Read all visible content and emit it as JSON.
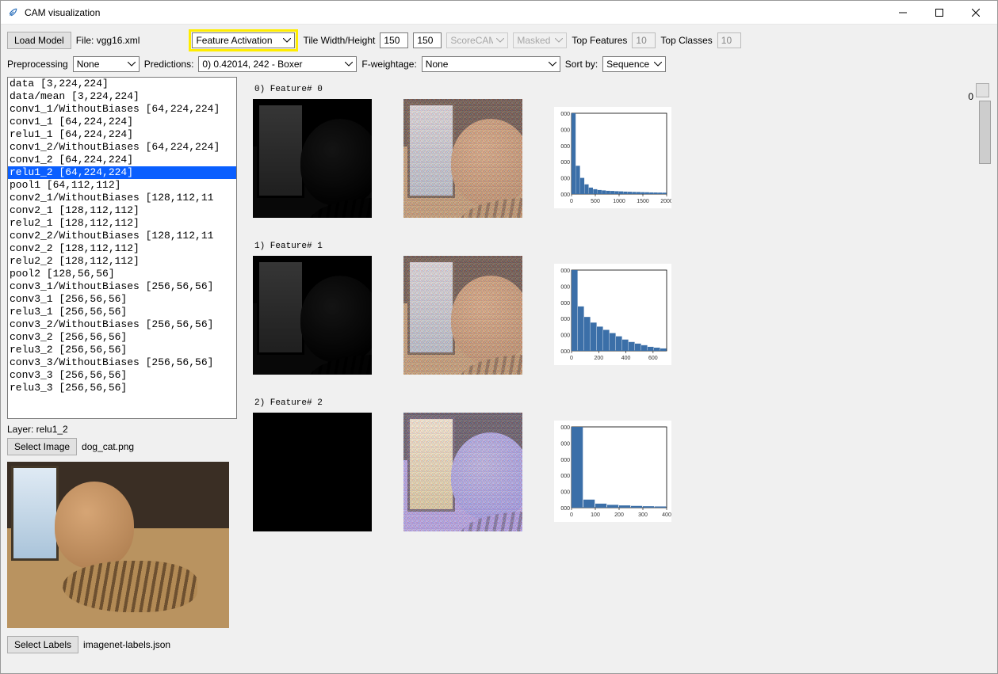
{
  "window": {
    "title": "CAM visualization"
  },
  "toolbar1": {
    "load_model": "Load Model",
    "file_label": "File:",
    "file_value": "vgg16.xml",
    "mode_select": "Feature Activation",
    "tile_label": "Tile Width/Height",
    "tile_w": "150",
    "tile_h": "150",
    "scorecam": "ScoreCAM",
    "masked": "Masked",
    "top_features_label": "Top Features",
    "top_features_value": "10",
    "top_classes_label": "Top Classes",
    "top_classes_value": "10"
  },
  "toolbar2": {
    "preproc_label": "Preprocessing",
    "preproc_value": "None",
    "pred_label": "Predictions:",
    "pred_value": "0) 0.42014,  242 - Boxer",
    "fweight_label": "F-weightage:",
    "fweight_value": "None",
    "sort_label": "Sort by:",
    "sort_value": "Sequence"
  },
  "layers": [
    {
      "name": "data",
      "shape": "[3,224,224]",
      "pad": 22
    },
    {
      "name": "data/mean",
      "shape": "[3,224,224]",
      "pad": 22
    },
    {
      "name": "conv1_1/WithoutBiases",
      "shape": "[64,224,224]",
      "pad": 2
    },
    {
      "name": "conv1_1",
      "shape": "[64,224,224]",
      "pad": 22
    },
    {
      "name": "relu1_1",
      "shape": "[64,224,224]",
      "pad": 22
    },
    {
      "name": "conv1_2/WithoutBiases",
      "shape": "[64,224,224]",
      "pad": 2
    },
    {
      "name": "conv1_2",
      "shape": "[64,224,224]",
      "pad": 22
    },
    {
      "name": "relu1_2",
      "shape": "[64,224,224]",
      "pad": 22,
      "selected": true
    },
    {
      "name": "pool1",
      "shape": "[64,112,112]",
      "pad": 22
    },
    {
      "name": "conv2_1/WithoutBiases",
      "shape": "[128,112,11",
      "pad": 2
    },
    {
      "name": "conv2_1",
      "shape": "[128,112,112]",
      "pad": 22
    },
    {
      "name": "relu2_1",
      "shape": "[128,112,112]",
      "pad": 22
    },
    {
      "name": "conv2_2/WithoutBiases",
      "shape": "[128,112,11",
      "pad": 2
    },
    {
      "name": "conv2_2",
      "shape": "[128,112,112]",
      "pad": 22
    },
    {
      "name": "relu2_2",
      "shape": "[128,112,112]",
      "pad": 22
    },
    {
      "name": "pool2",
      "shape": "[128,56,56]",
      "pad": 22
    },
    {
      "name": "conv3_1/WithoutBiases",
      "shape": "[256,56,56]",
      "pad": 2
    },
    {
      "name": "conv3_1",
      "shape": "[256,56,56]",
      "pad": 22
    },
    {
      "name": "relu3_1",
      "shape": "[256,56,56]",
      "pad": 22
    },
    {
      "name": "conv3_2/WithoutBiases",
      "shape": "[256,56,56]",
      "pad": 2
    },
    {
      "name": "conv3_2",
      "shape": "[256,56,56]",
      "pad": 22
    },
    {
      "name": "relu3_2",
      "shape": "[256,56,56]",
      "pad": 22
    },
    {
      "name": "conv3_3/WithoutBiases",
      "shape": "[256,56,56]",
      "pad": 2
    },
    {
      "name": "conv3_3",
      "shape": "[256,56,56]",
      "pad": 22
    },
    {
      "name": "relu3_3",
      "shape": "[256,56,56]",
      "pad": 22
    }
  ],
  "selected_layer_label": "Layer:   relu1_2",
  "select_image": "Select Image",
  "image_file": "dog_cat.png",
  "select_labels": "Select Labels",
  "labels_file": "imagenet-labels.json",
  "features": [
    {
      "title": "0) Feature# 0",
      "style": "grayscale",
      "chart": {
        "xmax": 2000,
        "ticks": [
          0,
          500,
          1000,
          1500,
          2000
        ],
        "bars": [
          1.0,
          0.35,
          0.2,
          0.12,
          0.08,
          0.06,
          0.05,
          0.045,
          0.04,
          0.038,
          0.035,
          0.033,
          0.03,
          0.028,
          0.026,
          0.025,
          0.023,
          0.022,
          0.02,
          0.019,
          0.018,
          0.017
        ]
      }
    },
    {
      "title": "1) Feature# 1",
      "style": "grayscale",
      "chart": {
        "xmax": 700,
        "ticks": [
          0,
          200,
          400,
          600
        ],
        "bars": [
          1.0,
          0.55,
          0.42,
          0.35,
          0.3,
          0.26,
          0.22,
          0.18,
          0.14,
          0.11,
          0.09,
          0.07,
          0.05,
          0.04,
          0.03
        ]
      }
    },
    {
      "title": "2) Feature# 2",
      "style": "dark",
      "overlay": "purplish",
      "chart": {
        "xmax": 400,
        "ticks": [
          0,
          100,
          200,
          300,
          400
        ],
        "bars": [
          1.0,
          0.1,
          0.05,
          0.035,
          0.028,
          0.022,
          0.018,
          0.015
        ]
      }
    }
  ],
  "scroll_value": "0",
  "chart_data": [
    {
      "type": "bar",
      "title": "Feature 0 histogram",
      "xlabel": "",
      "ylabel": "",
      "xlim": [
        0,
        2000
      ],
      "x_ticks": [
        0,
        500,
        1000,
        1500,
        2000
      ],
      "y_ticks_suffix": "000",
      "values": [
        1.0,
        0.35,
        0.2,
        0.12,
        0.08,
        0.06,
        0.05,
        0.045,
        0.04,
        0.038,
        0.035,
        0.033,
        0.03,
        0.028,
        0.026,
        0.025,
        0.023,
        0.022,
        0.02,
        0.019,
        0.018,
        0.017
      ]
    },
    {
      "type": "bar",
      "title": "Feature 1 histogram",
      "xlabel": "",
      "ylabel": "",
      "xlim": [
        0,
        700
      ],
      "x_ticks": [
        0,
        200,
        400,
        600
      ],
      "y_ticks_suffix": "000",
      "values": [
        1.0,
        0.55,
        0.42,
        0.35,
        0.3,
        0.26,
        0.22,
        0.18,
        0.14,
        0.11,
        0.09,
        0.07,
        0.05,
        0.04,
        0.03
      ]
    },
    {
      "type": "bar",
      "title": "Feature 2 histogram",
      "xlabel": "",
      "ylabel": "",
      "xlim": [
        0,
        400
      ],
      "x_ticks": [
        0,
        100,
        200,
        300,
        400
      ],
      "y_ticks_suffix": "000",
      "values": [
        1.0,
        0.1,
        0.05,
        0.035,
        0.028,
        0.022,
        0.018,
        0.015
      ]
    }
  ]
}
